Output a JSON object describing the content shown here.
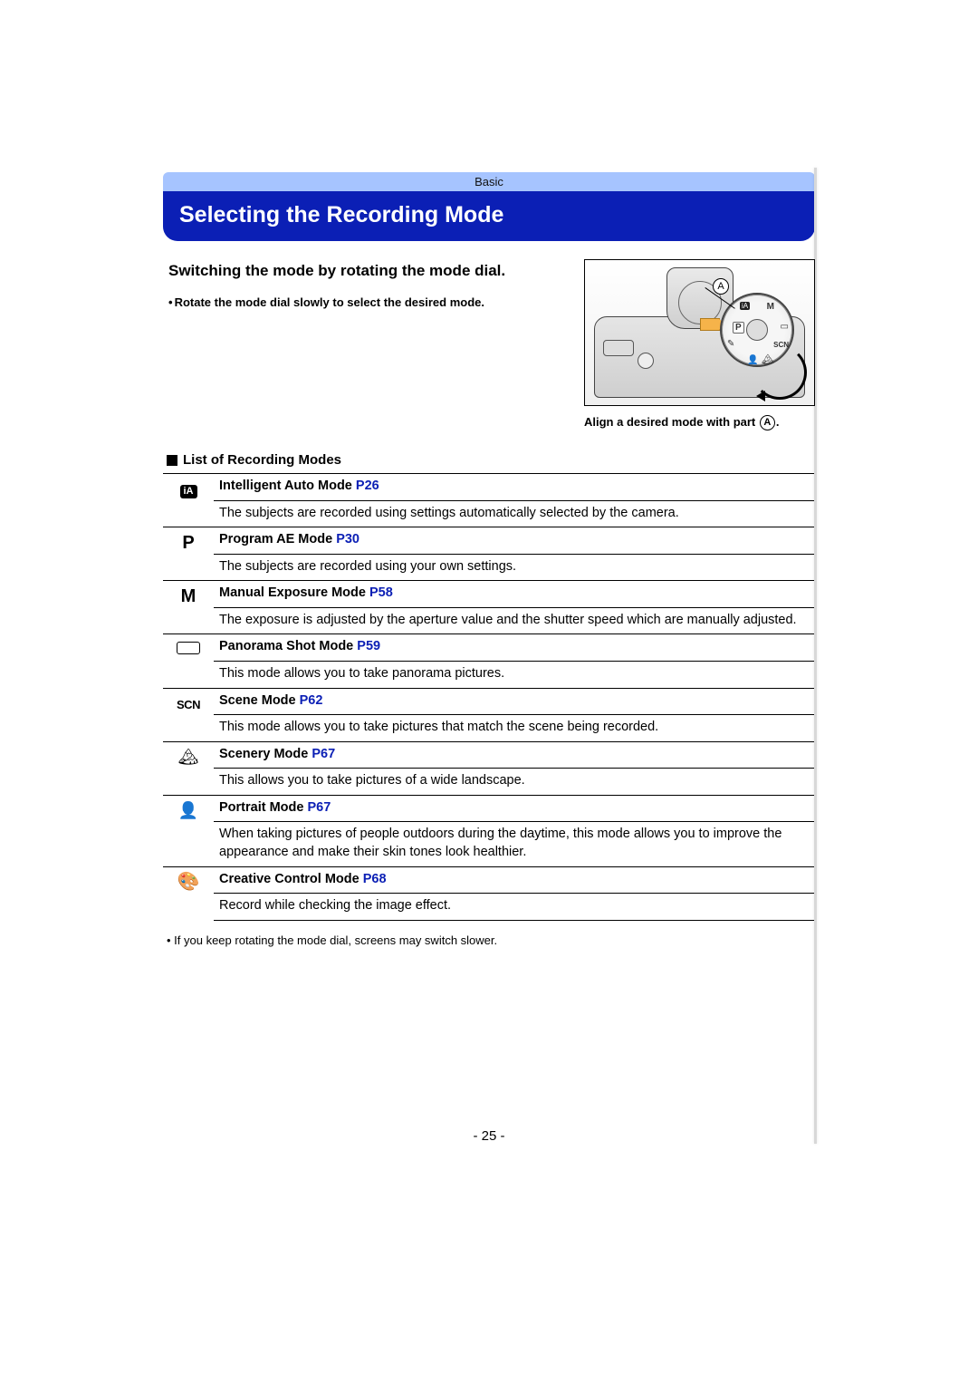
{
  "header": {
    "section": "Basic"
  },
  "title": "Selecting the Recording Mode",
  "subtitle": "Switching the mode by rotating the mode dial.",
  "instruction": "Rotate the mode dial slowly to select the desired mode.",
  "callout_letter": "A",
  "caption_prefix": "Align a desired mode with part ",
  "caption_suffix": ".",
  "list_heading": "List of Recording Modes",
  "modes": [
    {
      "name": "Intelligent Auto Mode",
      "page": "P26",
      "desc": "The subjects are recorded using settings automatically selected by the camera."
    },
    {
      "name": "Program AE Mode",
      "page": "P30",
      "desc": "The subjects are recorded using your own settings."
    },
    {
      "name": "Manual Exposure Mode",
      "page": "P58",
      "desc": "The exposure is adjusted by the aperture value and the shutter speed which are manually adjusted."
    },
    {
      "name": "Panorama Shot Mode",
      "page": "P59",
      "desc": "This mode allows you to take panorama pictures."
    },
    {
      "name": "Scene Mode",
      "page": "P62",
      "desc": "This mode allows you to take pictures that match the scene being recorded."
    },
    {
      "name": "Scenery Mode",
      "page": "P67",
      "desc": "This allows you to take pictures of a wide landscape."
    },
    {
      "name": "Portrait Mode",
      "page": "P67",
      "desc": "When taking pictures of people outdoors during the daytime, this mode allows you to improve the appearance and make their skin tones look healthier."
    },
    {
      "name": "Creative Control Mode",
      "page": "P68",
      "desc": "Record while checking the image effect."
    }
  ],
  "footnote": "If you keep rotating the mode dial, screens may switch slower.",
  "page_number": "- 25 -",
  "dial_labels": {
    "ia": "iA",
    "p": "P",
    "m": "M",
    "pano": "▭",
    "scn": "SCN",
    "scen": "🏔",
    "por": "👤",
    "cc": "✎"
  }
}
